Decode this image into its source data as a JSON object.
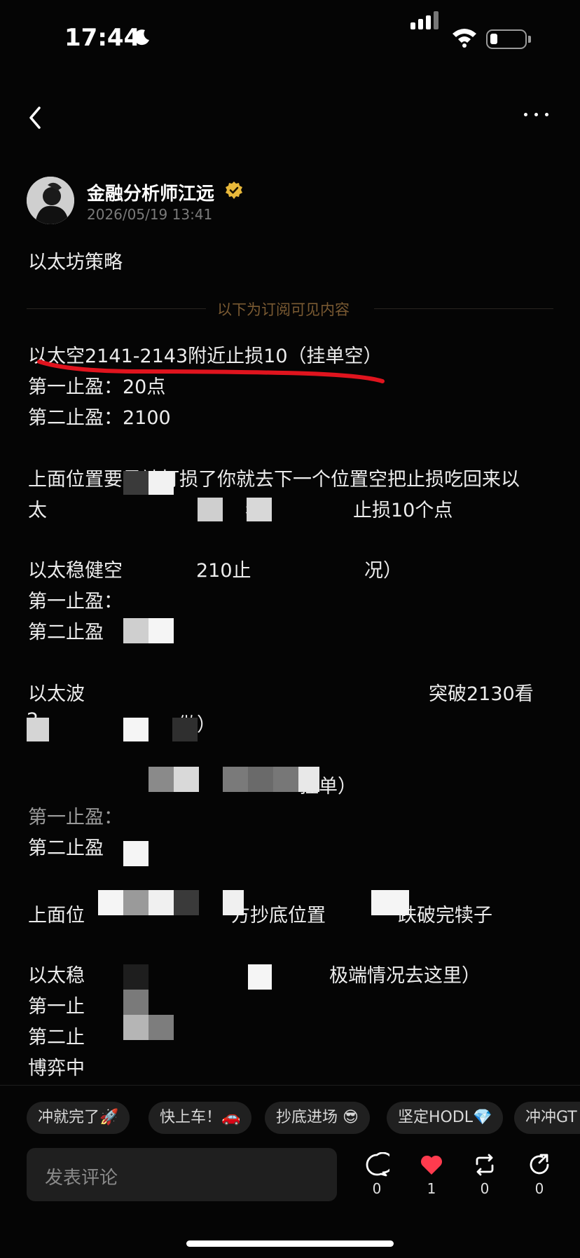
{
  "status_bar": {
    "time": "17:44"
  },
  "post": {
    "author_name": "金融分析师江远",
    "date": "2026/05/19 13:41",
    "title": "以太坊策略",
    "divider_label": "以下为订阅可见内容",
    "lines": [
      "以太空2141-2143附近止损10（挂单空）",
      "第一止盈：20点",
      "第二止盈：2100",
      "上面位置要是被打损了你就去下一个位置空把止损吃回来以",
      "太",
      "空",
      "看",
      "止损10个点",
      "以太稳健空",
      "210止",
      "况）",
      "第一止盈：",
      "第二止盈",
      "以太波",
      "突破2130看",
      "2",
      "做）",
      "挂单）",
      "第一止盈：",
      "第二止盈",
      "上面位",
      "方抄底位置",
      "跌破完犊子",
      "以太稳",
      "极端情况去这里）",
      "第一止",
      "第二止",
      "博弈中"
    ]
  },
  "quick_replies": [
    "冲就完了🚀",
    "快上车！🚗",
    "抄底进场 😎",
    "坚定HODL💎",
    "冲冲GT"
  ],
  "comment_placeholder": "发表评论",
  "actions": {
    "comment_count": "0",
    "like_count": "1",
    "repost_count": "0",
    "share_count": "0"
  },
  "colors": {
    "background": "#050505",
    "like_red": "#ff3b4e",
    "verified_gold": "#e8b83a",
    "divider_text": "#7a5a32",
    "annotation_red": "#e0141e"
  }
}
